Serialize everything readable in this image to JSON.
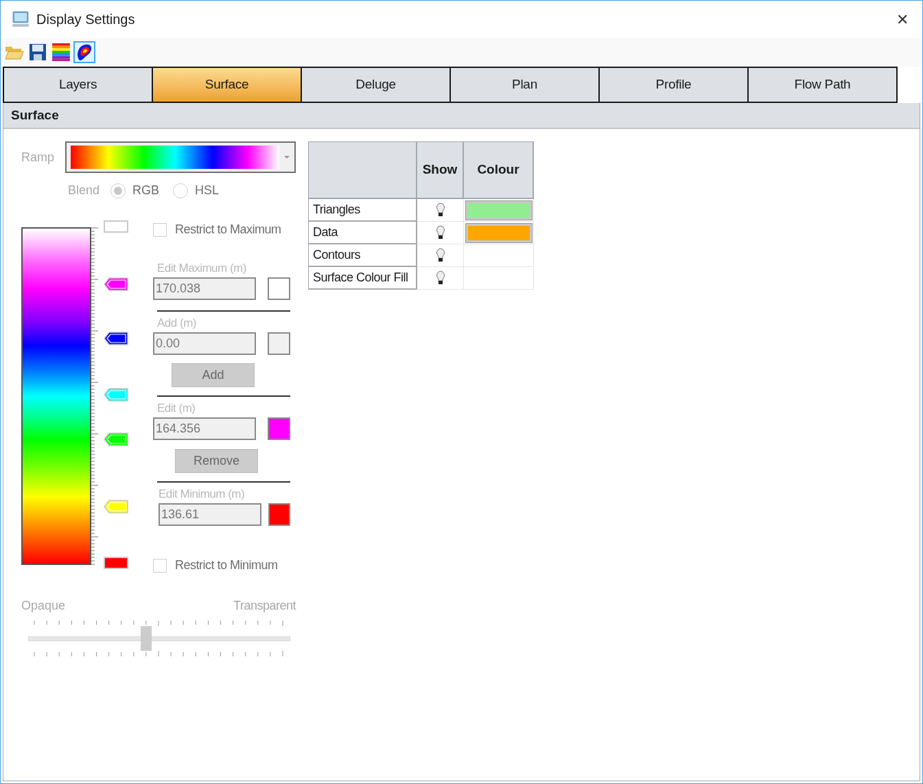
{
  "window": {
    "title": "Display Settings",
    "close": "✕"
  },
  "toolbar": [
    {
      "kind": "folder",
      "selected": false
    },
    {
      "kind": "save",
      "selected": false
    },
    {
      "kind": "rainbow",
      "selected": false
    },
    {
      "kind": "blob",
      "selected": true
    }
  ],
  "tabs": [
    {
      "label": "Layers",
      "selected": false
    },
    {
      "label": "Surface",
      "selected": true
    },
    {
      "label": "Deluge",
      "selected": false
    },
    {
      "label": "Plan",
      "selected": false
    },
    {
      "label": "Profile",
      "selected": false
    },
    {
      "label": "Flow Path",
      "selected": false
    }
  ],
  "section_title": "Surface",
  "ramp": {
    "label": "Ramp"
  },
  "blend": {
    "label": "Blend",
    "options": [
      {
        "label": "RGB",
        "selected": true
      },
      {
        "label": "HSL",
        "selected": false
      }
    ]
  },
  "markers": [
    {
      "kind": "end",
      "color": "#ffffff"
    },
    {
      "kind": "stop",
      "color": "#ff00ff"
    },
    {
      "kind": "stop",
      "color": "#0000ff"
    },
    {
      "kind": "stop",
      "color": "#00ffff"
    },
    {
      "kind": "stop",
      "color": "#00ff00"
    },
    {
      "kind": "stop",
      "color": "#ffff00"
    },
    {
      "kind": "end",
      "color": "#ff0000"
    }
  ],
  "restrict_max": {
    "label": "Restrict to Maximum",
    "checked": false
  },
  "edit_max": {
    "label": "Edit Maximum (m)",
    "value": "170.038",
    "color": "#ffffff"
  },
  "add": {
    "label": "Add (m)",
    "value": "0.00",
    "color": "#f0f0f0",
    "button": "Add"
  },
  "edit": {
    "label": "Edit (m)",
    "value": "164.356",
    "color": "#ff00ff",
    "button": "Remove"
  },
  "edit_min": {
    "label": "Edit Minimum (m)",
    "value": "136.61",
    "color": "#ff0000"
  },
  "restrict_min": {
    "label": "Restrict to Minimum",
    "checked": false
  },
  "opacity": {
    "min_label": "Opaque",
    "max_label": "Transparent",
    "level": 0.45
  },
  "layers_table": {
    "columns": [
      "Show",
      "Colour"
    ],
    "rows": [
      {
        "name": "Triangles",
        "color": "#90ee90"
      },
      {
        "name": "Data",
        "color": "#ffa500"
      },
      {
        "name": "Contours"
      },
      {
        "name": "Surface Colour Fill"
      }
    ]
  }
}
